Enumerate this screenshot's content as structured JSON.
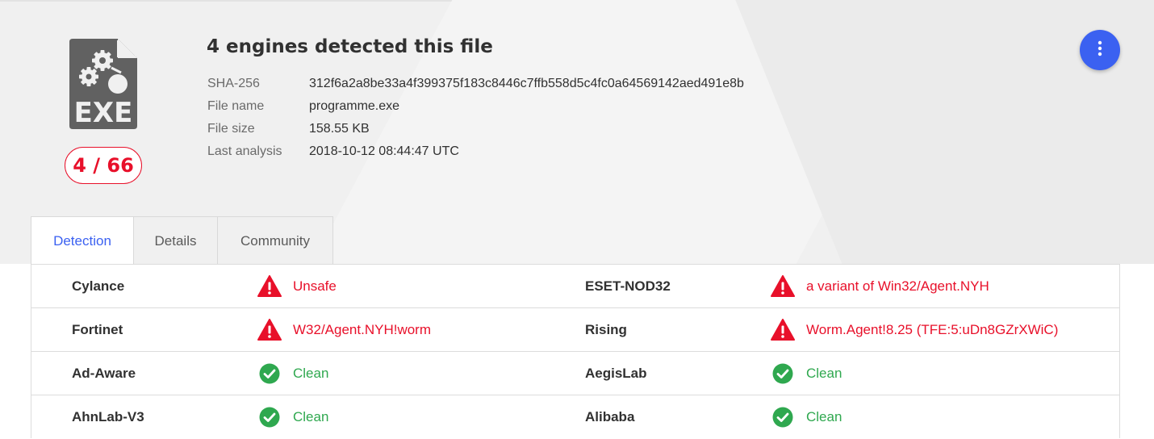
{
  "summary": {
    "title": "4 engines detected this file",
    "score": "4 / 66",
    "file_type_label": "EXE"
  },
  "meta": [
    {
      "key": "SHA-256",
      "value": "312f6a2a8be33a4f399375f183c8446c7ffb558d5c4fc0a64569142aed491e8b"
    },
    {
      "key": "File name",
      "value": "programme.exe"
    },
    {
      "key": "File size",
      "value": "158.55 KB"
    },
    {
      "key": "Last analysis",
      "value": "2018-10-12 08:44:47 UTC"
    }
  ],
  "tabs": [
    {
      "label": "Detection",
      "active": true
    },
    {
      "label": "Details",
      "active": false
    },
    {
      "label": "Community",
      "active": false
    }
  ],
  "detections": [
    {
      "left": {
        "engine": "Cylance",
        "result": "Unsafe",
        "status": "malicious"
      },
      "right": {
        "engine": "ESET-NOD32",
        "result": "a variant of Win32/Agent.NYH",
        "status": "malicious"
      }
    },
    {
      "left": {
        "engine": "Fortinet",
        "result": "W32/Agent.NYH!worm",
        "status": "malicious"
      },
      "right": {
        "engine": "Rising",
        "result": "Worm.Agent!8.25 (TFE:5:uDn8GZrXWiC)",
        "status": "malicious"
      }
    },
    {
      "left": {
        "engine": "Ad-Aware",
        "result": "Clean",
        "status": "clean"
      },
      "right": {
        "engine": "AegisLab",
        "result": "Clean",
        "status": "clean"
      }
    },
    {
      "left": {
        "engine": "AhnLab-V3",
        "result": "Clean",
        "status": "clean"
      },
      "right": {
        "engine": "Alibaba",
        "result": "Clean",
        "status": "clean"
      }
    }
  ],
  "icons": {
    "file": "exe-file-icon",
    "menu": "more-vertical-icon",
    "malicious": "warning-triangle-icon",
    "clean": "check-circle-icon"
  },
  "colors": {
    "accent": "#3b61f1",
    "malicious": "#e8102a",
    "clean": "#2fa84f"
  }
}
